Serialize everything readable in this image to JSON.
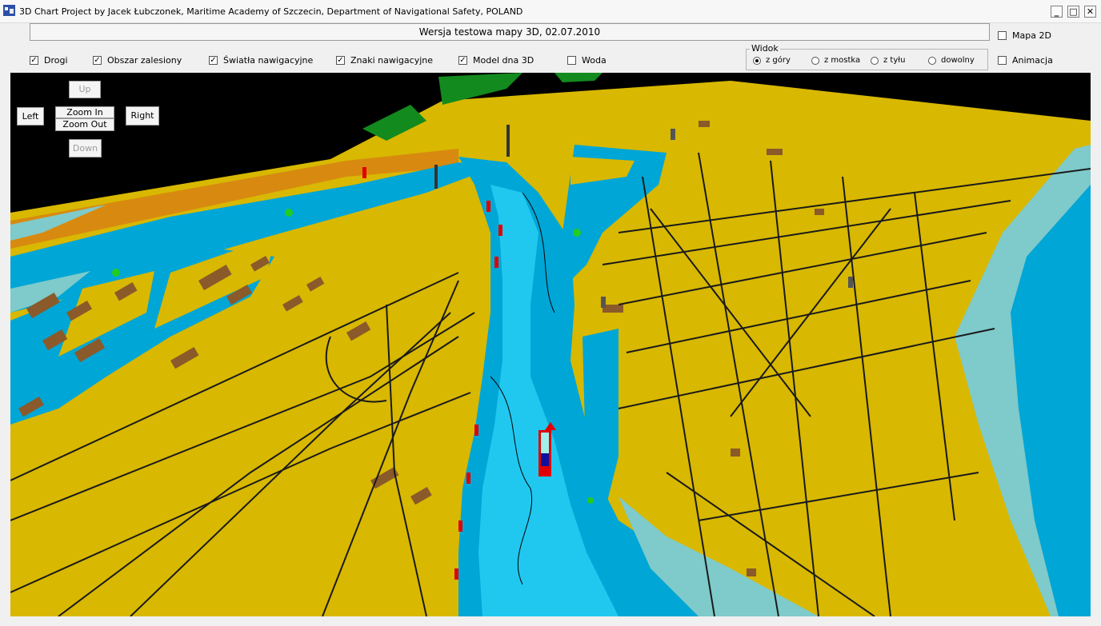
{
  "window": {
    "title": "3D Chart Project by Jacek Łubczonek, Maritime Academy of Szczecin, Department of Navigational Safety, POLAND",
    "minimize": "_",
    "maximize": "□",
    "close": "✕"
  },
  "banner": {
    "text": "Wersja testowa mapy 3D, 02.07.2010"
  },
  "layers": [
    {
      "label": "Drogi",
      "checked": true
    },
    {
      "label": "Obszar zalesiony",
      "checked": true
    },
    {
      "label": "Światła nawigacyjne",
      "checked": true
    },
    {
      "label": "Znaki nawigacyjne",
      "checked": true
    },
    {
      "label": "Model dna 3D",
      "checked": true
    },
    {
      "label": "Woda",
      "checked": false
    }
  ],
  "view_group": {
    "legend": "Widok",
    "options": [
      {
        "label": "z góry",
        "selected": true
      },
      {
        "label": "z mostka",
        "selected": false
      },
      {
        "label": "z tyłu",
        "selected": false
      },
      {
        "label": "dowolny",
        "selected": false
      }
    ]
  },
  "right_options": [
    {
      "label": "Mapa 2D",
      "checked": false
    },
    {
      "label": "Animacja",
      "checked": false
    }
  ],
  "nav": {
    "up": "Up",
    "left": "Left",
    "zoom_in": "Zoom In",
    "zoom_out": "Zoom Out",
    "right": "Right",
    "down": "Down"
  },
  "colors": {
    "land": "#d8b800",
    "embankment": "#d88a10",
    "water": "#00a6d6",
    "channel": "#20c8f0",
    "shallow": "#7fcaca",
    "forest": "#138a1e",
    "building": "#8a5a2a",
    "sky": "#000000"
  }
}
